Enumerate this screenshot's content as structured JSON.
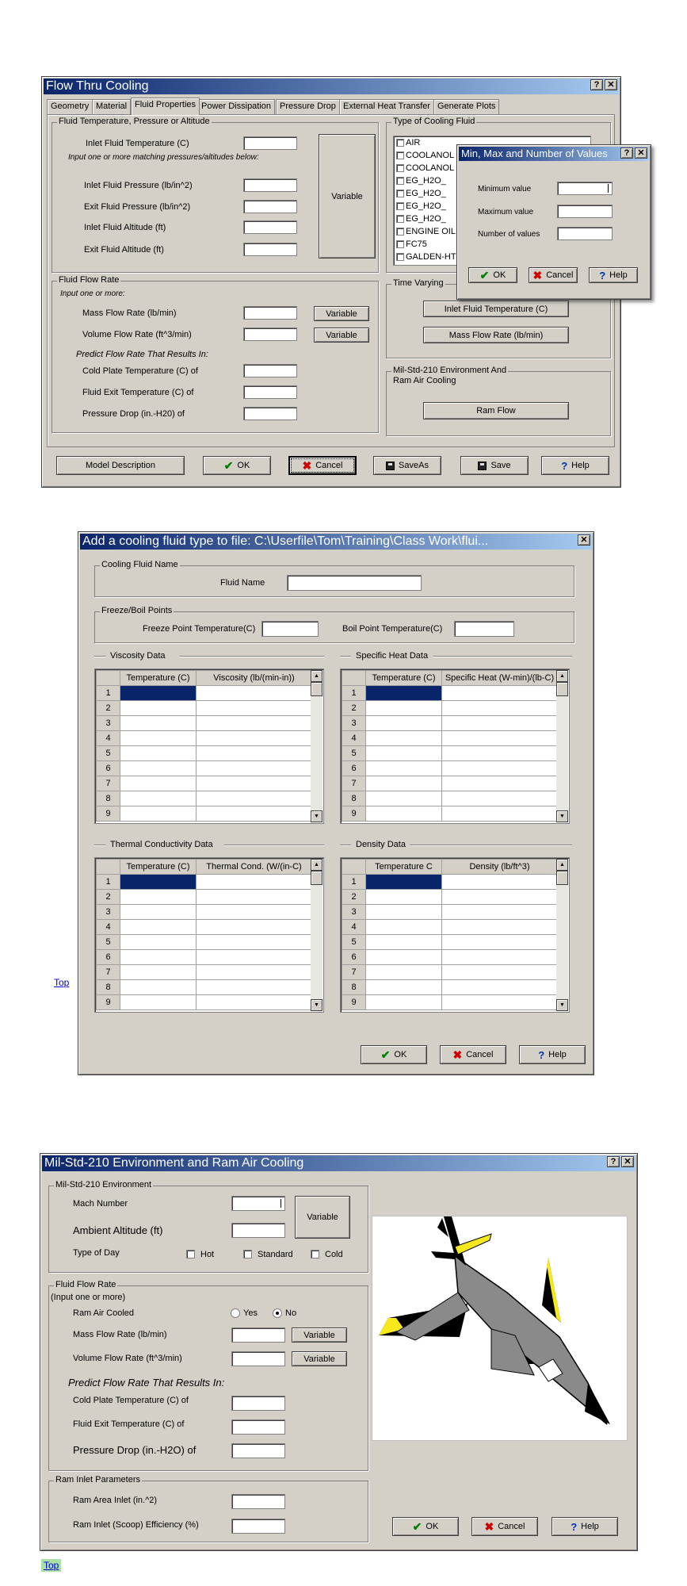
{
  "flow_window": {
    "title": "Flow Thru Cooling",
    "tabs": [
      "Geometry",
      "Material",
      "Fluid Properties",
      "Power Dissipation",
      "Pressure Drop",
      "External Heat Transfer",
      "Generate Plots"
    ],
    "temp_group": {
      "legend": "Fluid Temperature, Pressure or Altitude",
      "inlet_temp": "Inlet Fluid Temperature (C)",
      "hint": "Input one or more matching pressures/altitudes below:",
      "inlet_pressure": "Inlet Fluid Pressure (lb/in^2)",
      "exit_pressure": "Exit Fluid Pressure (lb/in^2)",
      "inlet_altitude": "Inlet Fluid Altitude (ft)",
      "exit_altitude": "Exit Fluid Altitude (ft)",
      "variable": "Variable"
    },
    "cooling_type": {
      "legend": "Type of Cooling Fluid",
      "items": [
        "AIR",
        "COOLANOL",
        "COOLANOL",
        "EG_H2O_",
        "EG_H2O_",
        "EG_H2O_",
        "EG_H2O_",
        "ENGINE OIL",
        "FC75",
        "GALDEN-HT"
      ]
    },
    "flow_rate": {
      "legend": "Fluid Flow Rate",
      "hint": "Input one or more:",
      "mass": "Mass Flow Rate (lb/min)",
      "volume": "Volume Flow Rate (ft^3/min)",
      "predict": "Predict Flow Rate That Results In:",
      "cold_plate": "Cold Plate Temperature (C) of",
      "fluid_exit": "Fluid Exit Temperature (C) of",
      "pressure_drop": "Pressure Drop (in.-H20) of",
      "variable": "Variable"
    },
    "time_varying": {
      "legend": "Time Varying",
      "inlet_temp_btn": "Inlet Fluid Temperature (C)",
      "mass_flow_btn": "Mass Flow Rate (lb/min)"
    },
    "mil_std": {
      "legend_line1": "Mil-Std-210 Environment And",
      "legend_line2": "Ram Air Cooling",
      "ram_flow_btn": "Ram Flow"
    },
    "buttons": {
      "model_desc": "Model Description",
      "ok": "OK",
      "cancel": "Cancel",
      "saveas": "SaveAs",
      "save": "Save",
      "help": "Help"
    }
  },
  "minmax_dialog": {
    "title": "Min, Max and Number of Values",
    "min": "Minimum value",
    "max": "Maximum value",
    "num": "Number of values",
    "ok": "OK",
    "cancel": "Cancel",
    "help": "Help"
  },
  "fluid_window": {
    "title": "Add a cooling fluid type to file: C:\\Userfile\\Tom\\Training\\Class Work\\flui...",
    "name_group": {
      "legend": "Cooling Fluid Name",
      "label": "Fluid Name"
    },
    "freeze_group": {
      "legend": "Freeze/Boil Points",
      "freeze": "Freeze Point Temperature(C)",
      "boil": "Boil Point Temperature(C)"
    },
    "grids": [
      {
        "title": "Viscosity Data",
        "col1": "Temperature (C)",
        "col2": "Viscosity (lb/(min-in))"
      },
      {
        "title": "Specific Heat Data",
        "col1": "Temperature (C)",
        "col2": "Specific Heat (W-min)/(lb-C)"
      },
      {
        "title": "Thermal Conductivity Data",
        "col1": "Temperature (C)",
        "col2": "Thermal Cond. (W/(in-C)"
      },
      {
        "title": "Density Data",
        "col1": "Temperature C",
        "col2": "Density (lb/ft^3)"
      }
    ],
    "rows": [
      "1",
      "2",
      "3",
      "4",
      "5",
      "6",
      "7",
      "8",
      "9"
    ],
    "ok": "OK",
    "cancel": "Cancel",
    "help": "Help"
  },
  "top_link_1": "Top",
  "ram_window": {
    "title": "Mil-Std-210 Environment and Ram Air Cooling",
    "env_group": {
      "legend": "Mil-Std-210 Environment",
      "mach": "Mach Number",
      "altitude": "Ambient Altitude (ft)",
      "type_of_day": "Type of Day",
      "hot": "Hot",
      "standard": "Standard",
      "cold": "Cold",
      "variable": "Variable"
    },
    "flow_group": {
      "legend": "Fluid Flow Rate",
      "hint": "(Input one or more)",
      "ram_cooled": "Ram Air Cooled",
      "yes": "Yes",
      "no": "No",
      "mass": "Mass Flow Rate (lb/min)",
      "volume": "Volume Flow Rate (ft^3/min)",
      "predict": "Predict Flow Rate That Results In:",
      "cold_plate": "Cold Plate Temperature (C) of",
      "fluid_exit": "Fluid Exit Temperature (C) of",
      "pressure_drop": "Pressure Drop (in.-H2O) of",
      "variable": "Variable"
    },
    "inlet_group": {
      "legend": "Ram Inlet Parameters",
      "area": "Ram Area Inlet (in.^2)",
      "efficiency": "Ram Inlet (Scoop) Efficiency (%)"
    },
    "ok": "OK",
    "cancel": "Cancel",
    "help": "Help"
  },
  "top_link_2": "Top"
}
